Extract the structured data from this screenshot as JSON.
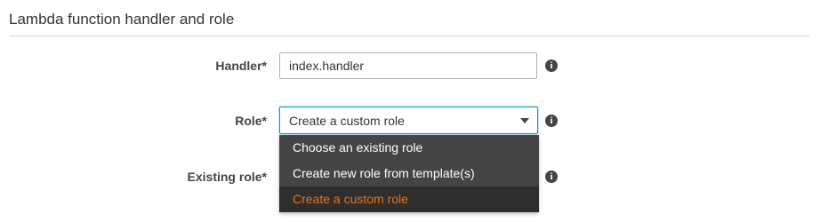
{
  "section": {
    "title": "Lambda function handler and role"
  },
  "handler": {
    "label": "Handler*",
    "value": "index.handler",
    "info_icon": "info-icon"
  },
  "role": {
    "label": "Role*",
    "selected": "Create a custom role",
    "info_icon": "info-icon",
    "options": [
      {
        "label": "Choose an existing role",
        "selected": false
      },
      {
        "label": "Create new role from template(s)",
        "selected": false
      },
      {
        "label": "Create a custom role",
        "selected": true
      }
    ]
  },
  "existing_role": {
    "label": "Existing role*",
    "info_icon": "info-icon"
  },
  "colors": {
    "focus_border": "#00a1c9",
    "dropdown_bg": "#444444",
    "dropdown_selected_bg": "#2e2e2e",
    "dropdown_selected_text": "#ec7211",
    "info_icon_bg": "#444444"
  },
  "icons": {
    "info": "i"
  }
}
